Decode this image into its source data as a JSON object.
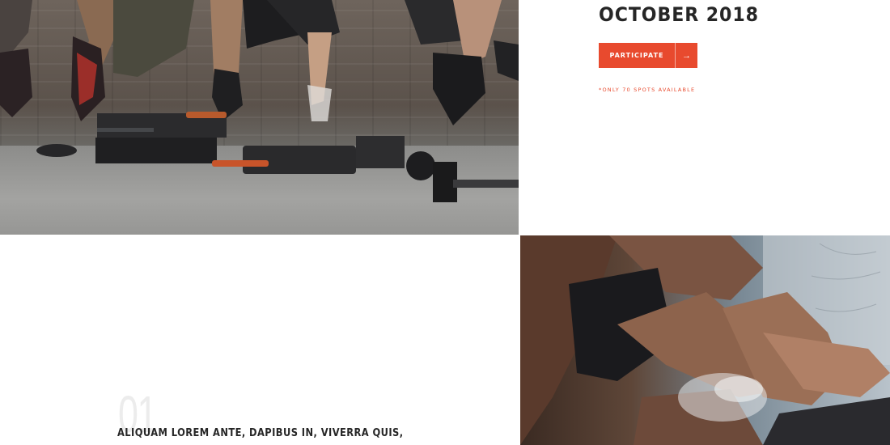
{
  "event": {
    "date": "OCTOBER 2018",
    "participate_label": "PARTICIPATE",
    "arrow_glyph": "→",
    "spots_note": "*ONLY 70 SPOTS AVAILABLE"
  },
  "feature": {
    "number": "01",
    "heading": "ALIQUAM LOREM ANTE, DAPIBUS IN, VIVERRA QUIS,"
  },
  "colors": {
    "accent": "#e84a2e",
    "heading_text": "#262626",
    "number_text": "#ececec"
  },
  "images": {
    "top_left": "people-jumping-gym-photo",
    "bottom_right": "athlete-chalk-hands-photo"
  }
}
